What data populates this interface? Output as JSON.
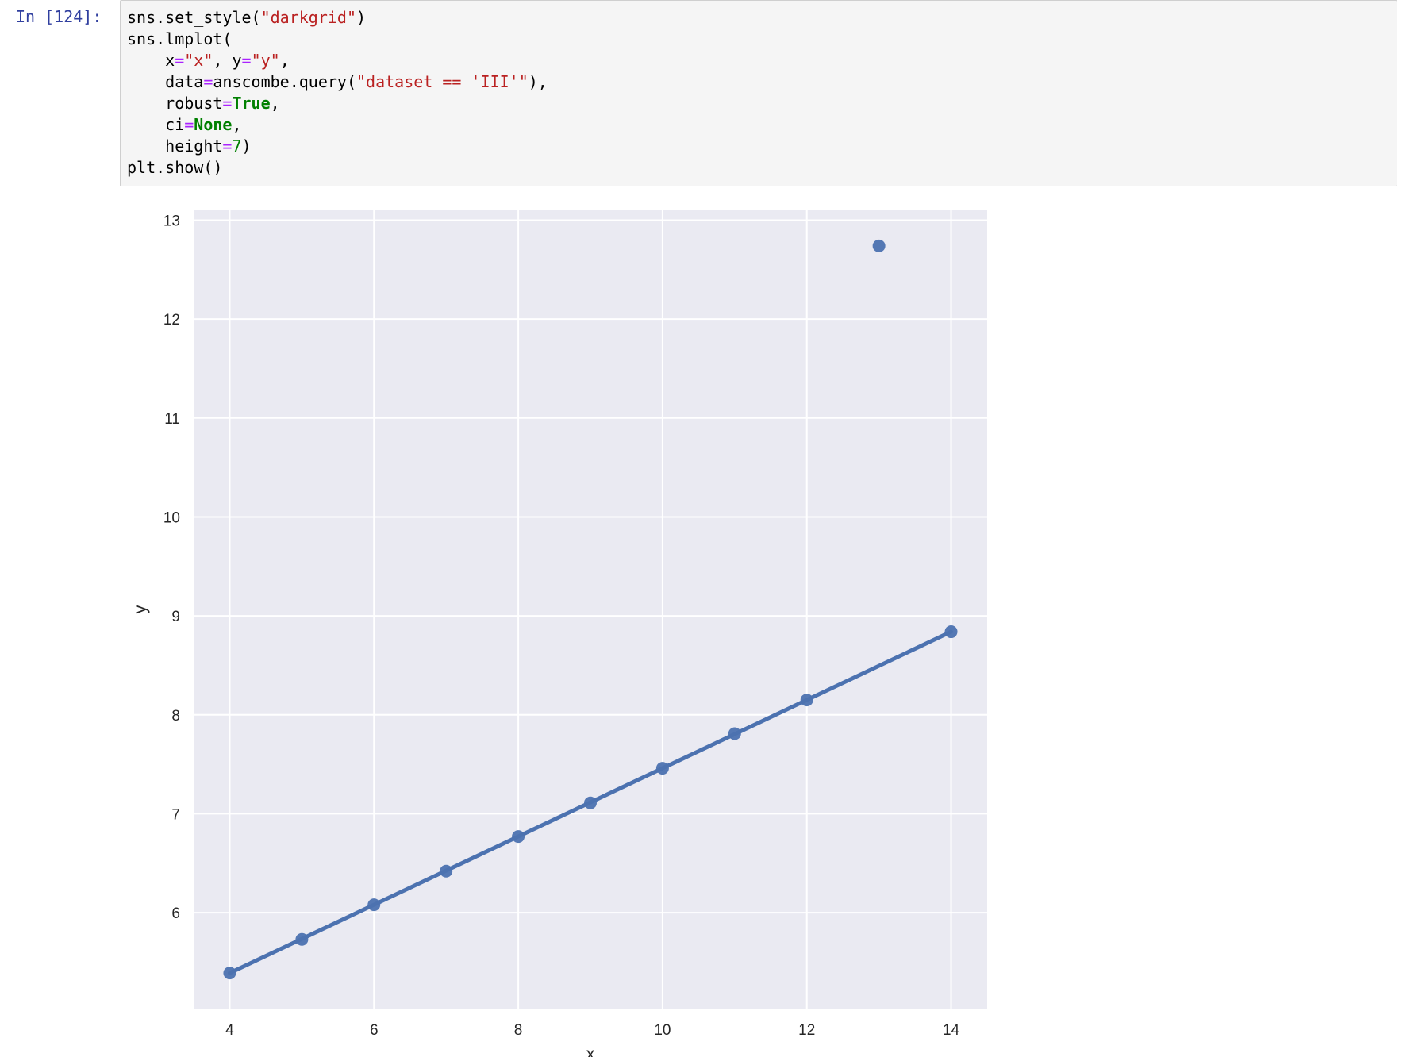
{
  "cell": {
    "prompt": "In [124]:",
    "code_lines": [
      [
        {
          "t": "sns.set_style(",
          "c": ""
        },
        {
          "t": "\"darkgrid\"",
          "c": "str"
        },
        {
          "t": ")",
          "c": ""
        }
      ],
      [
        {
          "t": "sns.lmplot(",
          "c": ""
        }
      ],
      [
        {
          "t": "    x",
          "c": ""
        },
        {
          "t": "=",
          "c": "op"
        },
        {
          "t": "\"x\"",
          "c": "str"
        },
        {
          "t": ", y",
          "c": ""
        },
        {
          "t": "=",
          "c": "op"
        },
        {
          "t": "\"y\"",
          "c": "str"
        },
        {
          "t": ",",
          "c": ""
        }
      ],
      [
        {
          "t": "    data",
          "c": ""
        },
        {
          "t": "=",
          "c": "op"
        },
        {
          "t": "anscombe.query(",
          "c": ""
        },
        {
          "t": "\"dataset == 'III'\"",
          "c": "str"
        },
        {
          "t": "),",
          "c": ""
        }
      ],
      [
        {
          "t": "    robust",
          "c": ""
        },
        {
          "t": "=",
          "c": "op"
        },
        {
          "t": "True",
          "c": "kw"
        },
        {
          "t": ",",
          "c": ""
        }
      ],
      [
        {
          "t": "    ci",
          "c": ""
        },
        {
          "t": "=",
          "c": "op"
        },
        {
          "t": "None",
          "c": "kw"
        },
        {
          "t": ",",
          "c": ""
        }
      ],
      [
        {
          "t": "    height",
          "c": ""
        },
        {
          "t": "=",
          "c": "op"
        },
        {
          "t": "7",
          "c": "num"
        },
        {
          "t": ")",
          "c": ""
        }
      ],
      [
        {
          "t": "plt.show()",
          "c": ""
        }
      ]
    ]
  },
  "chart_data": {
    "type": "scatter",
    "title": "",
    "xlabel": "x",
    "ylabel": "y",
    "xlim": [
      3.5,
      14.5
    ],
    "ylim": [
      5.03,
      13.1
    ],
    "xticks": [
      4,
      6,
      8,
      10,
      12,
      14
    ],
    "yticks": [
      6,
      7,
      8,
      9,
      10,
      11,
      12,
      13
    ],
    "grid": true,
    "style": "darkgrid",
    "colors": {
      "background": "#eaeaf2",
      "grid": "#ffffff",
      "series": "#4c72b0"
    },
    "points": {
      "x": [
        4,
        5,
        6,
        7,
        8,
        9,
        10,
        11,
        12,
        13,
        14
      ],
      "y": [
        5.39,
        5.73,
        6.08,
        6.42,
        6.77,
        7.11,
        7.46,
        7.81,
        8.15,
        12.74,
        8.84
      ]
    },
    "regression_line": {
      "x": [
        4,
        14
      ],
      "y": [
        5.39,
        8.84
      ]
    }
  }
}
